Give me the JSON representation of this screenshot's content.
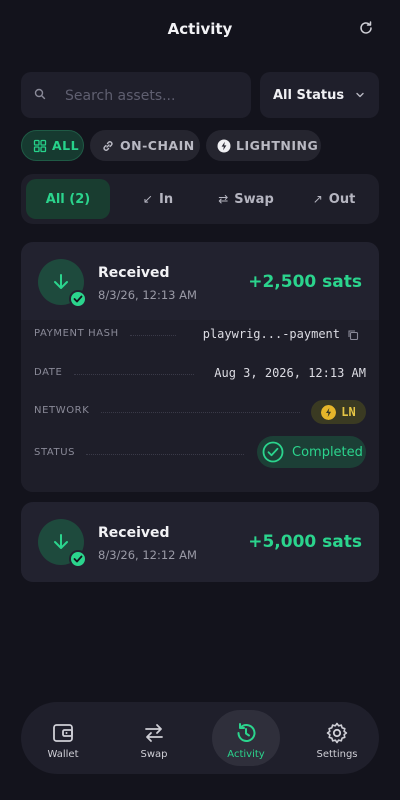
{
  "header": {
    "title": "Activity",
    "refresh_icon": "refresh-icon"
  },
  "search": {
    "placeholder": "Search assets...",
    "value": ""
  },
  "status_filter": {
    "selected": "All Status"
  },
  "network_chips": [
    {
      "label": "ALL",
      "icon": "grid-icon",
      "active": true
    },
    {
      "label": "ON-CHAIN",
      "icon": "link-icon",
      "active": false
    },
    {
      "label": "LIGHTNING",
      "icon": "bolt-icon",
      "active": false
    }
  ],
  "direction_tabs": [
    {
      "label": "All (2)",
      "active": true
    },
    {
      "label": "In",
      "icon": "↙",
      "active": false
    },
    {
      "label": "Swap",
      "icon": "⇄",
      "active": false
    },
    {
      "label": "Out",
      "icon": "↗",
      "active": false
    }
  ],
  "transactions": [
    {
      "type": "Received",
      "date": "8/3/26, 12:13 AM",
      "amount": "+2,500 sats",
      "expanded": true,
      "details": {
        "payment_hash_label": "PAYMENT HASH",
        "payment_hash": "playwrig...-payment",
        "date_label": "DATE",
        "date": "Aug 3, 2026, 12:13 AM",
        "network_label": "NETWORK",
        "network": "LN",
        "status_label": "STATUS",
        "status": "Completed"
      }
    },
    {
      "type": "Received",
      "date": "8/3/26, 12:12 AM",
      "amount": "+5,000 sats",
      "expanded": false
    }
  ],
  "bottom_nav": [
    {
      "label": "Wallet",
      "icon": "wallet-icon",
      "active": false
    },
    {
      "label": "Swap",
      "icon": "swap-icon",
      "active": false
    },
    {
      "label": "Activity",
      "icon": "history-icon",
      "active": true
    },
    {
      "label": "Settings",
      "icon": "gear-icon",
      "active": false
    }
  ],
  "colors": {
    "accent": "#2bd48d",
    "background": "#13131c",
    "card": "#22222f",
    "lightning": "#e5b52a"
  }
}
